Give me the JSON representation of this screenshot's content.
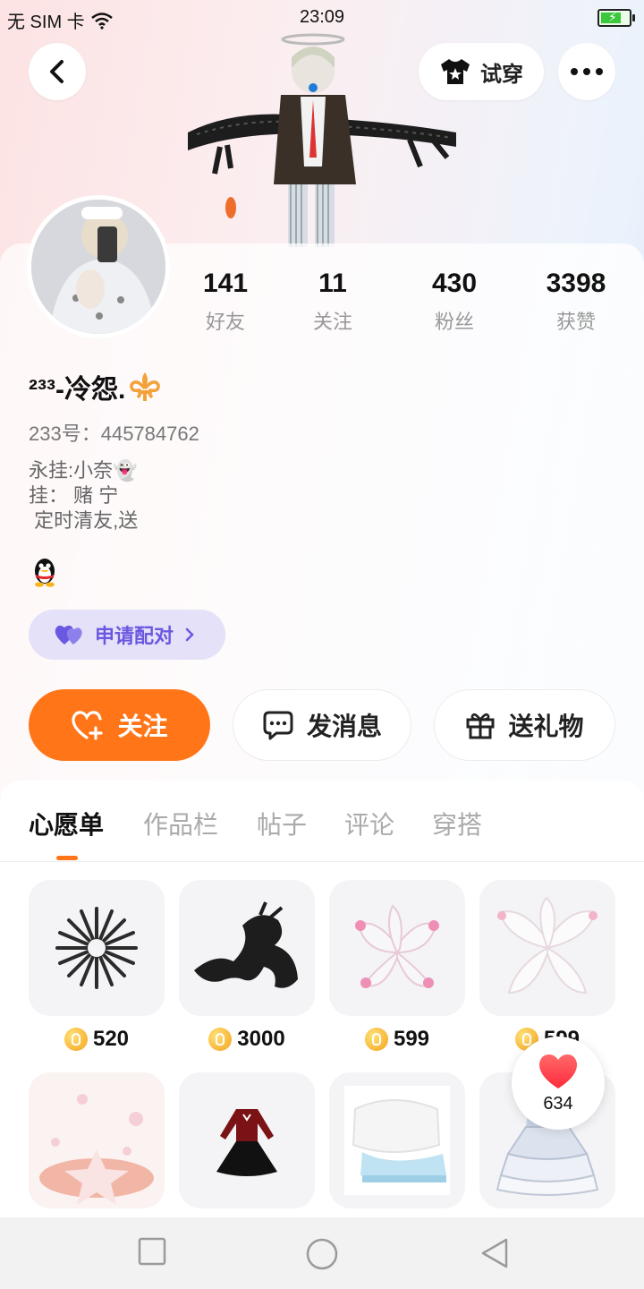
{
  "status_bar": {
    "carrier": "无 SIM 卡",
    "time": "23:09"
  },
  "top_bar": {
    "try_on_label": "试穿"
  },
  "profile": {
    "nickname": "²³³-冷怨.",
    "uid_label": "233号：",
    "uid": "445784762",
    "bio": "永挂:小奈👻\n挂： 赌 宁\n 定时清友,送",
    "stats": [
      {
        "value": "141",
        "label": "好友"
      },
      {
        "value": "11",
        "label": "关注"
      },
      {
        "value": "430",
        "label": "粉丝"
      },
      {
        "value": "3398",
        "label": "获赞"
      }
    ],
    "pair_label": "申请配对"
  },
  "actions": {
    "follow": "关注",
    "message": "发消息",
    "gift": "送礼物"
  },
  "tabs": [
    "心愿单",
    "作品栏",
    "帖子",
    "评论",
    "穿搭"
  ],
  "wishlist": [
    {
      "name": "blades-halo",
      "price": "520"
    },
    {
      "name": "black-dragon",
      "price": "3000"
    },
    {
      "name": "pink-fox-tails",
      "price": "599"
    },
    {
      "name": "white-fox-tails",
      "price": "599"
    },
    {
      "name": "sakura-effect"
    },
    {
      "name": "red-black-dress"
    },
    {
      "name": "white-fur-outfit"
    },
    {
      "name": "blue-ruffle-skirt"
    }
  ],
  "likes_float": {
    "count": "634"
  },
  "colors": {
    "accent": "#ff7518",
    "pair_purple": "#6a58e0",
    "heart_red": "#ff3b4a"
  }
}
